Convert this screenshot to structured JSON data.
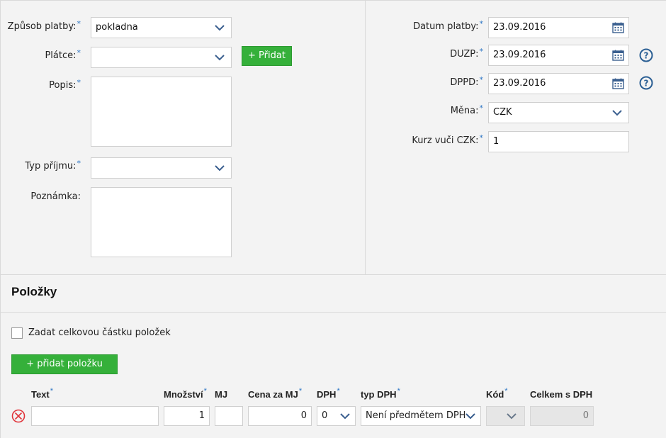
{
  "form": {
    "payment_method": {
      "label": "Způsob platby:",
      "value": "pokladna"
    },
    "payer": {
      "label": "Plátce:",
      "value": "",
      "add_label": "+ Přidat"
    },
    "description": {
      "label": "Popis:"
    },
    "income_type": {
      "label": "Typ příjmu:",
      "value": ""
    },
    "note": {
      "label": "Poznámka:"
    },
    "payment_date": {
      "label": "Datum platby:",
      "value": "23.09.2016"
    },
    "duzp": {
      "label": "DUZP:",
      "value": "23.09.2016"
    },
    "dppd": {
      "label": "DPPD:",
      "value": "23.09.2016"
    },
    "currency": {
      "label": "Měna:",
      "value": "CZK"
    },
    "rate": {
      "label": "Kurz vuči CZK:",
      "value": "1"
    },
    "required_mark": "*"
  },
  "items": {
    "title": "Položky",
    "total_checkbox_label": "Zadat celkovou částku položek",
    "add_item_label": "+ přidat položku",
    "columns": {
      "text": "Text",
      "quantity": "Množství",
      "unit": "MJ",
      "unit_price": "Cena za MJ",
      "vat": "DPH",
      "vat_type": "typ DPH",
      "code": "Kód",
      "total_with_vat": "Celkem s DPH"
    },
    "row": {
      "text": "",
      "quantity": "1",
      "unit": "",
      "unit_price": "0",
      "vat": "0",
      "vat_type": "Není předmětem DPH",
      "code": "",
      "total_with_vat": "0"
    }
  },
  "colors": {
    "accent": "#35b03a",
    "required": "#2b74c4",
    "chevron": "#3a5f8f",
    "remove": "#e0333a"
  }
}
